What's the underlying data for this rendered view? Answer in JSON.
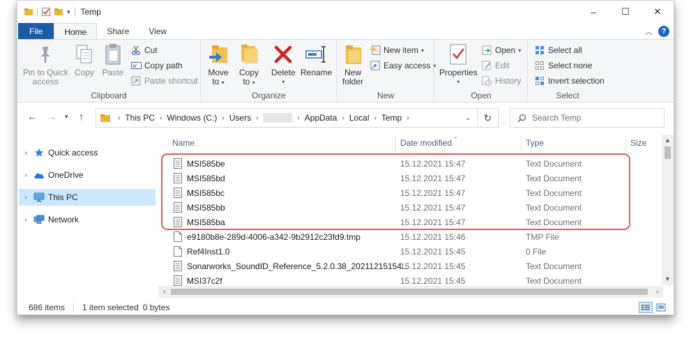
{
  "window": {
    "title": "Temp"
  },
  "window_controls": {
    "minimize": "–",
    "maximize": "☐",
    "close": "✕"
  },
  "tabs": [
    {
      "label": "File"
    },
    {
      "label": "Home"
    },
    {
      "label": "Share"
    },
    {
      "label": "View"
    }
  ],
  "ribbon": {
    "clipboard": {
      "label": "Clipboard",
      "pin_label_1": "Pin to Quick",
      "pin_label_2": "access",
      "copy_label": "Copy",
      "paste_label": "Paste",
      "cut_label": "Cut",
      "copy_path_label": "Copy path",
      "paste_shortcut_label": "Paste shortcut"
    },
    "organize": {
      "label": "Organize",
      "move_label_1": "Move",
      "move_label_2": "to",
      "copy_label_1": "Copy",
      "copy_label_2": "to",
      "delete_label": "Delete",
      "rename_label": "Rename"
    },
    "new": {
      "label": "New",
      "new_folder_label_1": "New",
      "new_folder_label_2": "folder",
      "new_item_label": "New item",
      "easy_access_label": "Easy access"
    },
    "open": {
      "label": "Open",
      "properties_label": "Properties",
      "open_label": "Open",
      "edit_label": "Edit",
      "history_label": "History"
    },
    "select": {
      "label": "Select",
      "select_all_label": "Select all",
      "select_none_label": "Select none",
      "invert_label": "Invert selection"
    }
  },
  "address": {
    "crumbs": [
      "This PC",
      "Windows (C:)",
      "Users",
      "AppData",
      "Local",
      "Temp"
    ]
  },
  "search": {
    "placeholder": "Search Temp"
  },
  "navpane": {
    "items": [
      {
        "label": "Quick access"
      },
      {
        "label": "OneDrive"
      },
      {
        "label": "This PC"
      },
      {
        "label": "Network"
      }
    ]
  },
  "columns": {
    "name": "Name",
    "date": "Date modified",
    "type": "Type",
    "size": "Size"
  },
  "files": [
    {
      "name": "MSI585be",
      "date": "15.12.2021 15:47",
      "type": "Text Document"
    },
    {
      "name": "MSI585bd",
      "date": "15.12.2021 15:47",
      "type": "Text Document"
    },
    {
      "name": "MSI585bc",
      "date": "15.12.2021 15:47",
      "type": "Text Document"
    },
    {
      "name": "MSI585bb",
      "date": "15.12.2021 15:47",
      "type": "Text Document"
    },
    {
      "name": "MSI585ba",
      "date": "15.12.2021 15:47",
      "type": "Text Document"
    },
    {
      "name": "e9180b8e-289d-4006-a342-9b2912c23fd9.tmp",
      "date": "15.12.2021 15:46",
      "type": "TMP File"
    },
    {
      "name": "Ref4Inst1.0",
      "date": "15.12.2021 15:45",
      "type": "0 File"
    },
    {
      "name": "Sonarworks_SoundID_Reference_5.2.0.38_20211215154...",
      "date": "15.12.2021 15:45",
      "type": "Text Document"
    },
    {
      "name": "MSI37c2f",
      "date": "15.12.2021 15:45",
      "type": "Text Document"
    }
  ],
  "status": {
    "items": "686 items",
    "selected": "1 item selected",
    "size": "0 bytes"
  },
  "colors": {
    "accent": "#1a5ba6",
    "selection": "#cce8ff",
    "highlight": "#e05b55"
  }
}
